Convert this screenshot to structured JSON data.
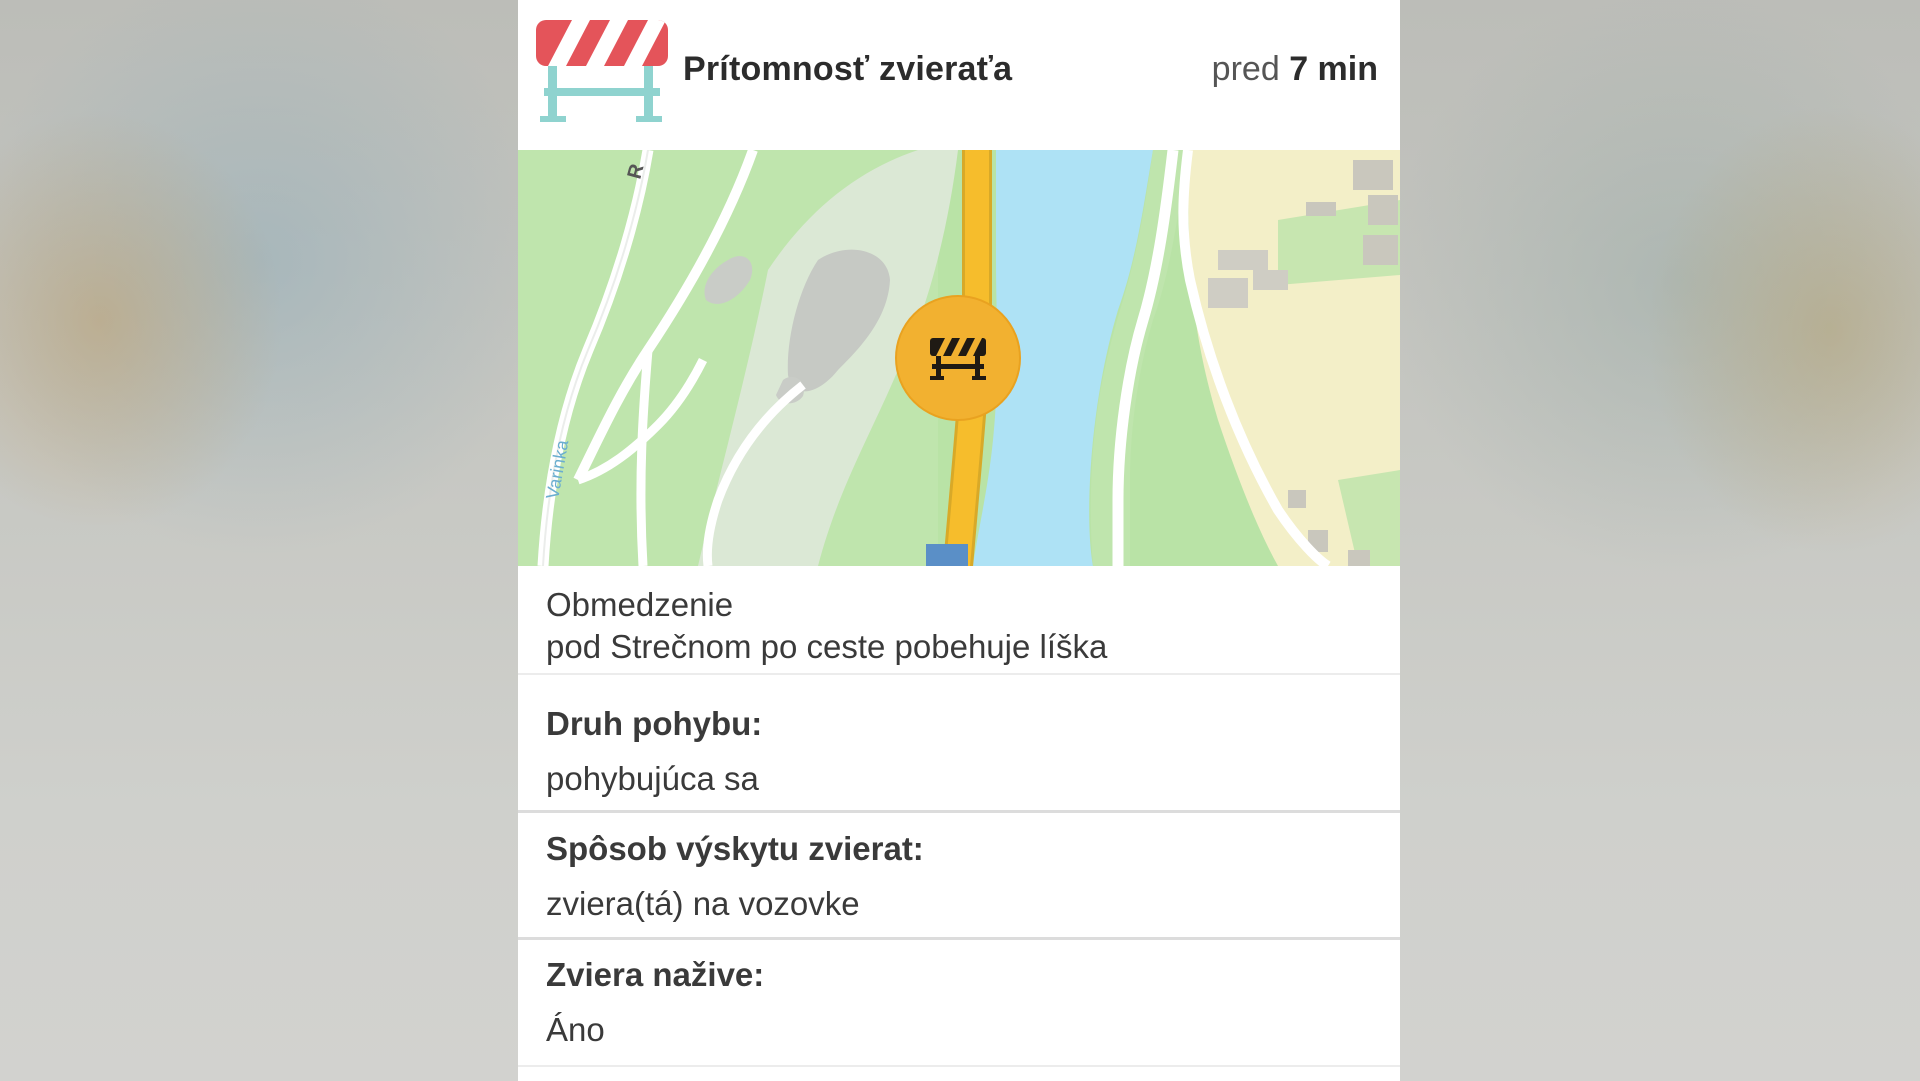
{
  "header": {
    "title": "Prítomnosť zvieraťa",
    "time_prefix": "pred",
    "time_value": "7 min"
  },
  "map": {
    "road_label_top": "R",
    "river_label": "Varinka",
    "marker_icon": "road-barrier-icon",
    "marker_color": "#f2b130",
    "road_color": "#f6bd2c",
    "river_color": "#aee2f5"
  },
  "restriction": {
    "label": "Obmedzenie",
    "description": "pod Strečnom po ceste pobehuje líška"
  },
  "details": [
    {
      "label": "Druh pohybu:",
      "value": "pohybujúca sa"
    },
    {
      "label": "Spôsob výskytu zvierat:",
      "value": "zviera(tá) na vozovke"
    },
    {
      "label": "Zviera nažive:",
      "value": "Áno"
    }
  ],
  "colors": {
    "barrier_red": "#e4545a",
    "barrier_stand": "#8fd3cf"
  }
}
